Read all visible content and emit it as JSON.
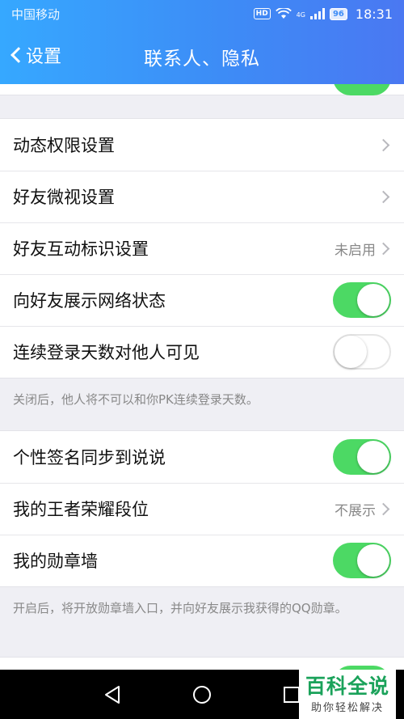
{
  "status_bar": {
    "carrier": "中国移动",
    "hd": "HD",
    "network": "4G",
    "battery": "96",
    "time": "18:31"
  },
  "header": {
    "back_label": "设置",
    "title": "联系人、隐私"
  },
  "groups": [
    {
      "rows": [
        {
          "label": "动态权限设置"
        },
        {
          "label": "好友微视设置"
        },
        {
          "label": "好友互动标识设置",
          "value": "未启用"
        },
        {
          "label": "向好友展示网络状态",
          "toggle": true
        },
        {
          "label": "连续登录天数对他人可见",
          "toggle": false
        }
      ],
      "note": "关闭后，他人将不可以和你PK连续登录天数。"
    },
    {
      "rows": [
        {
          "label": "个性签名同步到说说",
          "toggle": true
        },
        {
          "label": "我的王者荣耀段位",
          "value": "不展示"
        },
        {
          "label": "我的勋章墙",
          "toggle": true
        }
      ],
      "note": "开启后，将开放勋章墙入口，并向好友展示我获得的QQ勋章。"
    }
  ],
  "watermark": {
    "main": "百科全说",
    "sub": "助你轻松解决"
  },
  "colors": {
    "header_start": "#36a8ff",
    "header_end": "#4a78f2",
    "toggle_on": "#4cd964",
    "watermark_green": "#1aa25a"
  }
}
